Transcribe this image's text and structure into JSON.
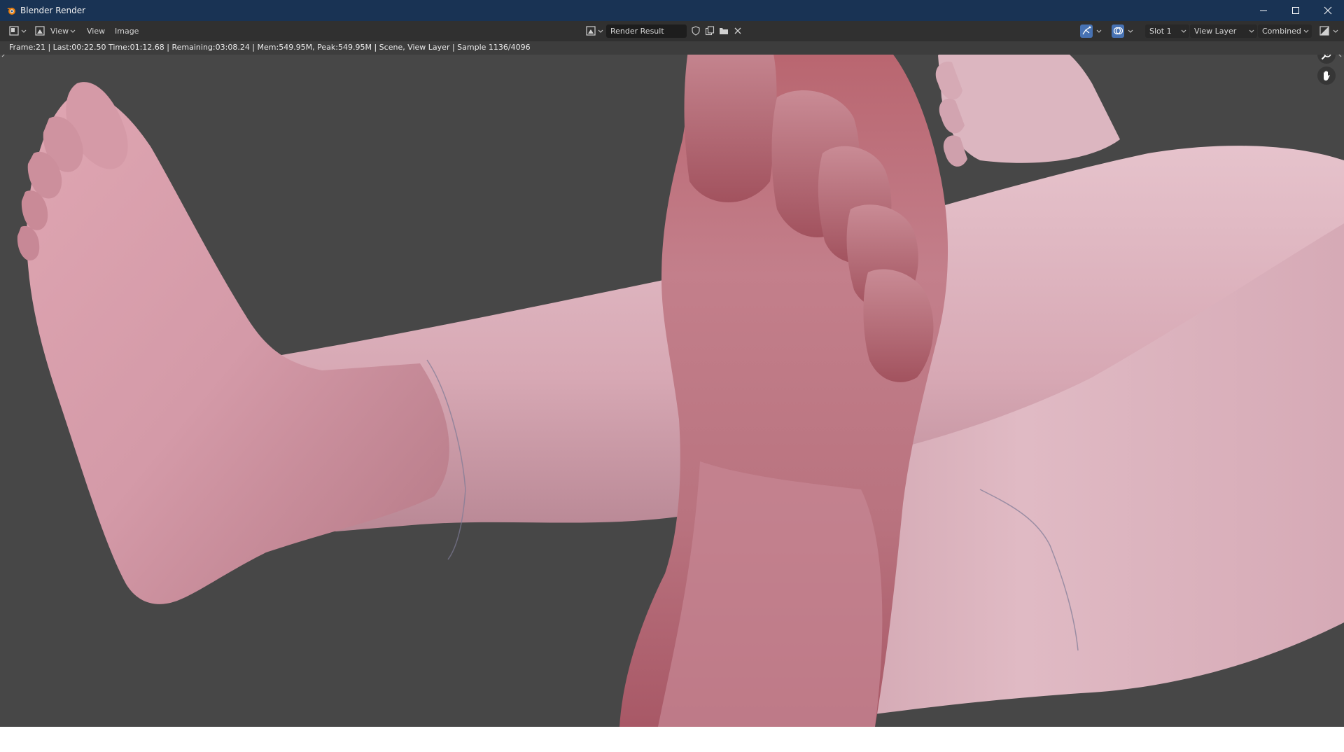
{
  "window": {
    "title": "Blender Render",
    "controls": [
      "minimize",
      "maximize",
      "close"
    ]
  },
  "header": {
    "editor_type_icon": "image-editor-icon",
    "mode_icon": "view-mode-icon",
    "view_dropdown_label": "View",
    "menus": [
      {
        "label": "View"
      },
      {
        "label": "Image"
      }
    ],
    "image_browse_icon": "image-browse-icon",
    "image_name": "Render Result",
    "image_actions": [
      "fake-user-icon",
      "new-image-icon",
      "open-image-icon",
      "unlink-icon"
    ],
    "gizmo_toggle_icon": "gizmo-icon",
    "overlay_toggle_icon": "overlay-icon",
    "slot": "Slot 1",
    "view_layer": "View Layer",
    "render_pass": "Combined",
    "display_channels_icon": "display-channels-icon"
  },
  "render_info": "Frame:21 | Last:00:22.50 Time:01:12.68 | Remaining:03:08.24 | Mem:549.95M, Peak:549.95M | Scene, View Layer | Sample 1136/4096",
  "navigation": {
    "zoom_icon": "zoom-icon",
    "pan_icon": "hand-pan-icon"
  },
  "colors": {
    "titlebar": "#193354",
    "header": "#303030",
    "viewport_background": "#474747",
    "skin_light": "#e3bcc6",
    "skin_mid": "#cf98a6",
    "skin_dark": "#a1525e"
  }
}
